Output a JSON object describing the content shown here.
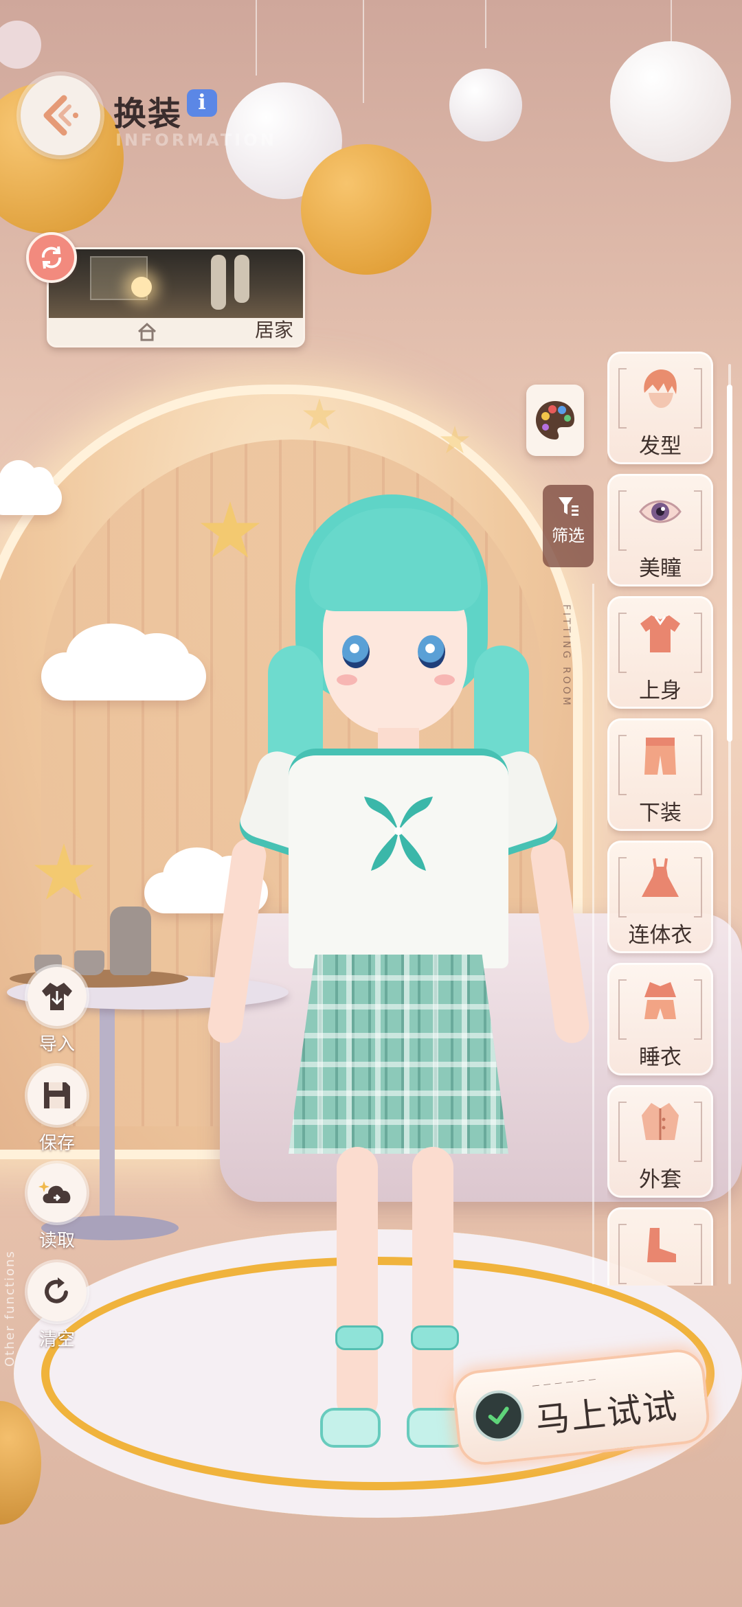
{
  "header": {
    "title": "换装",
    "info_glyph": "i",
    "subtitle": "INFORMATION"
  },
  "scene": {
    "label": "居家"
  },
  "filter": {
    "label": "筛选"
  },
  "side_caption": "FITTING ROOM",
  "categories": [
    {
      "label": "发型",
      "icon": "hair-icon"
    },
    {
      "label": "美瞳",
      "icon": "eye-icon"
    },
    {
      "label": "上身",
      "icon": "shirt-icon"
    },
    {
      "label": "下装",
      "icon": "pants-icon"
    },
    {
      "label": "连体衣",
      "icon": "dress-icon"
    },
    {
      "label": "睡衣",
      "icon": "pajamas-icon"
    },
    {
      "label": "外套",
      "icon": "coat-icon"
    },
    {
      "label": "",
      "icon": "shoes-icon"
    }
  ],
  "functions": {
    "import_label": "导入",
    "save_label": "保存",
    "load_label": "读取",
    "clear_label": "清空",
    "caption": "Other functions"
  },
  "try_now": {
    "label": "马上试试"
  },
  "colors": {
    "accent": "#f28a7e",
    "hair": "#5fd4c7",
    "info": "#5b87e6"
  }
}
